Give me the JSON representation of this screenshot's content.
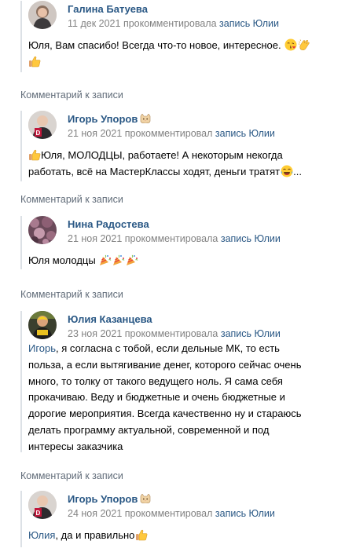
{
  "comments": [
    {
      "author": "Галина Батуева",
      "date": "11 дек 2021",
      "action": "прокомментировала",
      "post_link": "запись Юлии",
      "text": "Юля, Вам спасибо! Всегда что-то новое, интересное.",
      "emojis": [
        "kiss-emoji",
        "clap-emoji",
        "thumbs-up-emoji"
      ]
    },
    {
      "section_label": "Комментарий к записи",
      "author": "Игорь Упоров",
      "author_badge": "cat-icon",
      "date": "21 ноя 2021",
      "action": "прокомментировал",
      "post_link": "запись Юлии",
      "text_line1": "Юля, МОЛОДЦЫ, работаете! А некоторым некогда",
      "text_line2": "работать, всё на МастерКлассы ходят, деньги тратят",
      "text_end": "..."
    },
    {
      "section_label": "Комментарий к записи",
      "author": "Нина Радостева",
      "date": "21 ноя 2021",
      "action": "прокомментировала",
      "post_link": "запись Юлии",
      "text": "Юля молодцы",
      "emojis": [
        "party-popper-emoji",
        "party-popper-emoji",
        "party-popper-emoji"
      ]
    },
    {
      "section_label": "Комментарий к записи",
      "author": "Юлия Казанцева",
      "date": "23 ноя 2021",
      "action": "прокомментировала",
      "post_link": "запись Юлии",
      "mention": "Игорь",
      "lines": [
        ", я согласна с тобой, если дельные МК, то есть",
        "польза, а если вытягивание денег, которого сейчас очень",
        "много, то толку от такого ведущего ноль. Я сама себя",
        "прокачиваю. Веду и бюджетные и очень бюджетные и",
        "дорогие мероприятия. Всегда качественно ну и стараюсь",
        "делать программу актуальной, современной и под",
        "интересы заказчика"
      ]
    },
    {
      "section_label": "Комментарий к записи",
      "author": "Игорь Упоров",
      "author_badge": "cat-icon",
      "date": "24 ноя 2021",
      "action": "прокомментировал",
      "post_link": "запись Юлии",
      "mention": "Юлия",
      "text": ", да и правильно",
      "emojis": [
        "thumbs-up-emoji"
      ]
    }
  ],
  "colors": {
    "link": "#2a5885",
    "meta": "#828282",
    "section_label": "#626d7a",
    "bar": "#dce1e6"
  }
}
